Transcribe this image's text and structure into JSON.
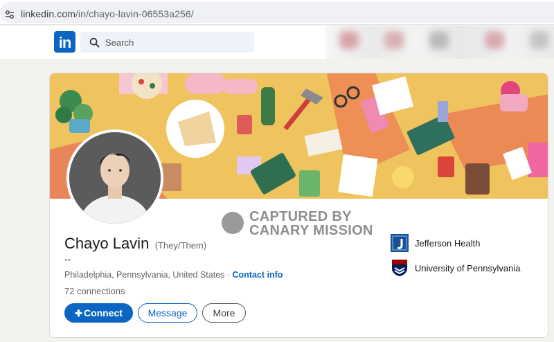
{
  "browser": {
    "url_host": "linkedin.com",
    "url_path": "/in/chayo-lavin-06553a256/"
  },
  "nav": {
    "logo_text": "in",
    "search_placeholder": "Search"
  },
  "profile": {
    "name": "Chayo Lavin",
    "pronouns": "(They/Them)",
    "headline": "--",
    "location": "Philadelphia, Pennsylvania, United States",
    "location_separator": " · ",
    "contact_info": "Contact info",
    "connections": "72 connections"
  },
  "actions": {
    "connect_label": "Connect",
    "message_label": "Message",
    "more_label": "More"
  },
  "watermark": {
    "line1": "CAPTURED BY",
    "line2": "CANARY MISSION"
  },
  "organizations": [
    {
      "name": "Jefferson Health",
      "icon": "jefferson-logo-icon"
    },
    {
      "name": "University of Pennsylvania",
      "icon": "upenn-shield-icon"
    }
  ],
  "colors": {
    "linkedin_blue": "#0a66c2",
    "page_bg": "#f4f2ee",
    "banner_bg": "#f0c25a"
  }
}
